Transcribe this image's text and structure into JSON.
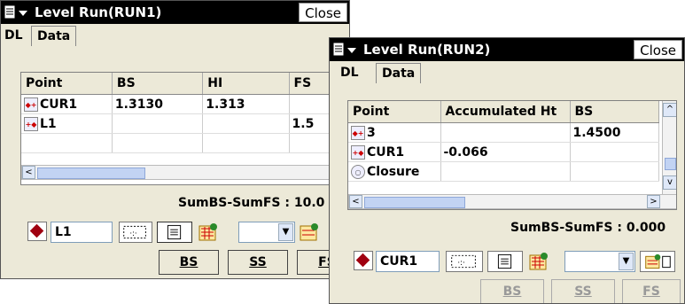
{
  "win1": {
    "title": "Level Run(RUN1)",
    "close_label": "Close",
    "tabs": [
      {
        "label": "DL"
      },
      {
        "label": "Data"
      }
    ],
    "columns": [
      "Point",
      "BS",
      "HI",
      "FS"
    ],
    "rows": [
      {
        "point": "CUR1",
        "bs": "1.3130",
        "hi": "1.313",
        "fs": ""
      },
      {
        "point": "L1",
        "bs": "",
        "hi": "",
        "fs": "1.5"
      },
      {
        "point": "",
        "bs": "",
        "hi": "",
        "fs": ""
      }
    ],
    "sum_text": "SumBS-SumFS : 10.0",
    "point_value": "L1",
    "combo_value": "",
    "buttons": [
      "BS",
      "SS",
      "FS"
    ]
  },
  "win2": {
    "title": "Level Run(RUN2)",
    "close_label": "Close",
    "tabs": [
      {
        "label": "DL"
      },
      {
        "label": "Data"
      }
    ],
    "columns": [
      "Point",
      "Accumulated Ht",
      "BS"
    ],
    "rows": [
      {
        "point": "3",
        "acc": "",
        "bs": "1.4500"
      },
      {
        "point": "CUR1",
        "acc": "-0.066",
        "bs": ""
      },
      {
        "point": "Closure",
        "acc": "",
        "bs": ""
      }
    ],
    "sum_text": "SumBS-SumFS : 0.000",
    "point_value": "CUR1",
    "combo_value": "",
    "buttons": [
      "BS",
      "SS",
      "FS"
    ]
  }
}
